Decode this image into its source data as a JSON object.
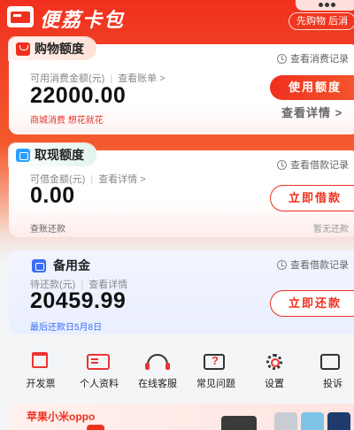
{
  "app": {
    "brand": "便荔卡包",
    "promo_pill": "先购物 后消"
  },
  "shopping_card": {
    "title": "购物额度",
    "record_link": "查看消费记录",
    "label": "可用消费金额(元)",
    "sub_link": "查看账单 >",
    "amount": "22000.00",
    "note": "商城消费 想花就花",
    "primary_button": "使用额度",
    "detail_link": "查看详情 >"
  },
  "cash_card": {
    "title": "取现额度",
    "record_link": "查看借款记录",
    "label": "可借金额(元)",
    "sub_link": "查看详情 >",
    "amount": "0.00",
    "button": "立即借款",
    "footer_left": "查账还款",
    "footer_right": "暂无还款"
  },
  "backup_card": {
    "title": "备用金",
    "record_link": "查看借款记录",
    "label": "待还款(元)",
    "sub_link": "查看详情",
    "amount": "20459.99",
    "button": "立即还款",
    "due_note": "最后还款日5月8日"
  },
  "quick_menu": [
    {
      "label": "开发票",
      "icon": "invoice-icon"
    },
    {
      "label": "个人资料",
      "icon": "profile-card-icon"
    },
    {
      "label": "在线客服",
      "icon": "headset-icon"
    },
    {
      "label": "常见问题",
      "icon": "faq-icon"
    },
    {
      "label": "设置",
      "icon": "gear-icon"
    },
    {
      "label": "投诉",
      "icon": "complaint-icon"
    }
  ],
  "promo": {
    "title": "苹果小米oppo"
  },
  "colors": {
    "primary": "#f0301e",
    "accent_blue": "#3b6cf5"
  }
}
